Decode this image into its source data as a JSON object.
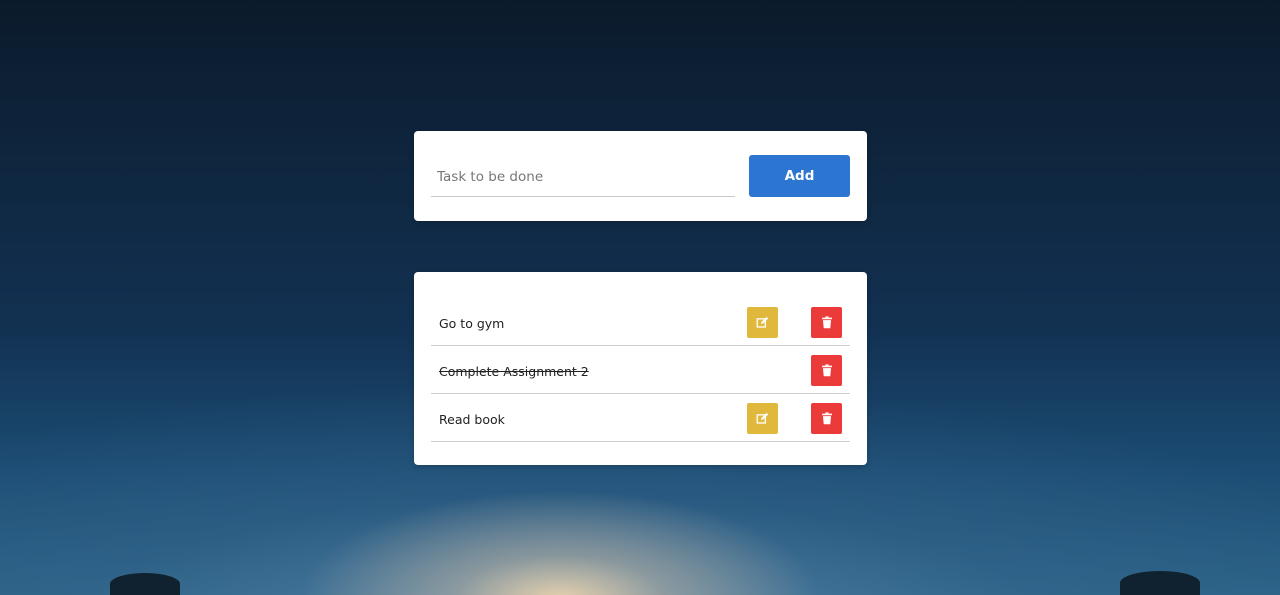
{
  "form": {
    "placeholder": "Task to be done",
    "add_label": "Add"
  },
  "tasks": [
    {
      "label": "Go to gym",
      "completed": false,
      "actions": [
        "edit-icon",
        "trash-icon"
      ]
    },
    {
      "label": "Complete Assignment 2",
      "completed": true,
      "actions": [
        "trash-icon"
      ]
    },
    {
      "label": "Read book",
      "completed": false,
      "actions": [
        "edit-icon",
        "trash-icon"
      ]
    }
  ],
  "colors": {
    "add_button": "#2c75d1",
    "edit_button": "#e0b83c",
    "delete_button": "#ea3a3a"
  }
}
